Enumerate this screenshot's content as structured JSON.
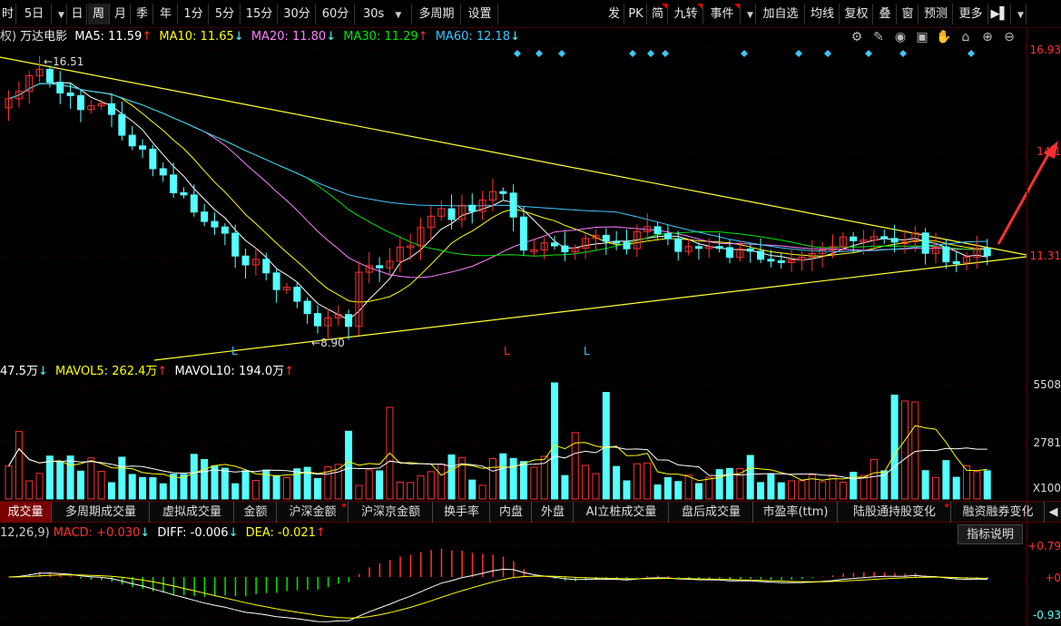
{
  "toolbar": {
    "items": [
      {
        "label": "时"
      },
      {
        "label": "5日"
      },
      {
        "label": "日"
      },
      {
        "label": "周"
      },
      {
        "label": "月"
      },
      {
        "label": "季"
      },
      {
        "label": "年"
      },
      {
        "label": "1分"
      },
      {
        "label": "5分"
      },
      {
        "label": "15分"
      },
      {
        "label": "30分"
      },
      {
        "label": "60分"
      },
      {
        "label": "30s"
      },
      {
        "label": "多周期"
      },
      {
        "label": "设置"
      }
    ],
    "right_items": [
      {
        "label": "发"
      },
      {
        "label": "PK"
      },
      {
        "label": "简"
      },
      {
        "label": "九转"
      },
      {
        "label": "事件"
      },
      {
        "label": "加自选"
      },
      {
        "label": "均线"
      },
      {
        "label": "复权"
      },
      {
        "label": "叠"
      },
      {
        "label": "窗"
      },
      {
        "label": "预测"
      },
      {
        "label": "更多"
      }
    ],
    "active": "周"
  },
  "ma_line": {
    "prefix": "权)",
    "stock": "万达电影",
    "ma5": "MA5: 11.59",
    "ma5_arrow": "↑",
    "ma10": "MA10: 11.65",
    "ma10_arrow": "↓",
    "ma20": "MA20: 11.80",
    "ma20_arrow": "↓",
    "ma30": "MA30: 11.29",
    "ma30_arrow": "↑",
    "ma60": "MA60: 12.18",
    "ma60_arrow": "↓"
  },
  "price_chart": {
    "high_label": "16.51",
    "low_label": "8.90",
    "axis_labels": [
      "16.93",
      "14.1",
      "11.31"
    ]
  },
  "vol_line": {
    "vol": "47.5万",
    "vol_arrow": "↓",
    "mavol5": "MAVOL5: 262.4万",
    "mavol5_arrow": "↑",
    "mavol10": "MAVOL10: 194.0万",
    "mavol10_arrow": "↑"
  },
  "vol_chart": {
    "axis_labels": [
      "5508",
      "2781",
      "X100"
    ]
  },
  "tabs": [
    {
      "label": "成交量"
    },
    {
      "label": "多周期成交量"
    },
    {
      "label": "虚拟成交量"
    },
    {
      "label": "金额"
    },
    {
      "label": "沪深金额"
    },
    {
      "label": "沪深京金额"
    },
    {
      "label": "换手率"
    },
    {
      "label": "内盘"
    },
    {
      "label": "外盘"
    },
    {
      "label": "AI立桩成交量"
    },
    {
      "label": "盘后成交量"
    },
    {
      "label": "市盈率(ttm)"
    },
    {
      "label": "陆股通持股变化"
    },
    {
      "label": "融资融券变化"
    }
  ],
  "macd_line": {
    "prefix": "12,26,9)",
    "macd": "MACD: +0.030",
    "macd_arrow": "↓",
    "diff": "DIFF: -0.006",
    "diff_arrow": "↓",
    "dea": "DEA: -0.021",
    "dea_arrow": "↑"
  },
  "macd_chart": {
    "axis_labels": [
      "+0.79",
      "+0",
      "-0.93"
    ],
    "explain_label": "指标说明"
  },
  "colors": {
    "up": "#ff3232",
    "down": "#54ffff",
    "ma5": "#ffffff",
    "ma10": "#ffff00",
    "ma20": "#ff80ff",
    "ma30": "#00e600",
    "ma60": "#3cc8ff"
  }
}
